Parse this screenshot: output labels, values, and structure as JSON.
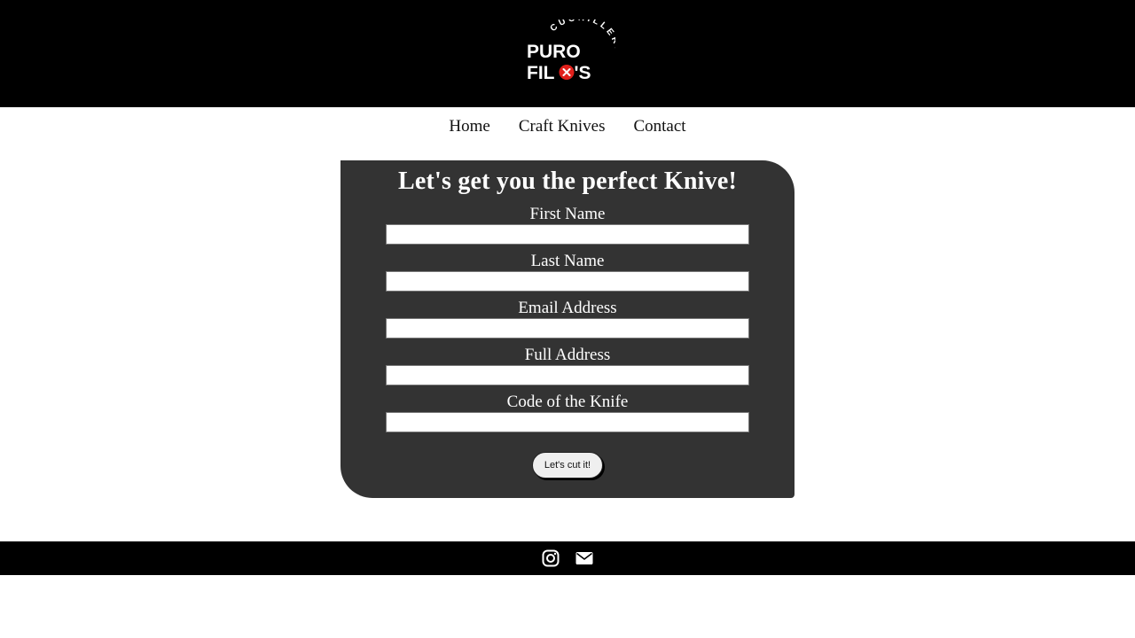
{
  "header": {
    "logo": {
      "top_text": "CUCHILLERIA",
      "line1": "PURO",
      "line2": "FIL",
      "line2_end": "'S",
      "icon": "x-circle-icon",
      "accent_color": "#e0201b"
    }
  },
  "nav": {
    "items": [
      {
        "label": "Home"
      },
      {
        "label": "Craft Knives"
      },
      {
        "label": "Contact"
      }
    ]
  },
  "form": {
    "title": "Let's get you the perfect Knive!",
    "fields": [
      {
        "label": "First Name",
        "value": "",
        "placeholder": ""
      },
      {
        "label": "Last Name",
        "value": "",
        "placeholder": ""
      },
      {
        "label": "Email Address",
        "value": "",
        "placeholder": ""
      },
      {
        "label": "Full Address",
        "value": "",
        "placeholder": ""
      },
      {
        "label": "Code of the Knife",
        "value": "",
        "placeholder": ""
      }
    ],
    "submit_label": "Let's cut it!",
    "background_color": "#333333"
  },
  "footer": {
    "icons": [
      "instagram-icon",
      "envelope-icon"
    ]
  }
}
